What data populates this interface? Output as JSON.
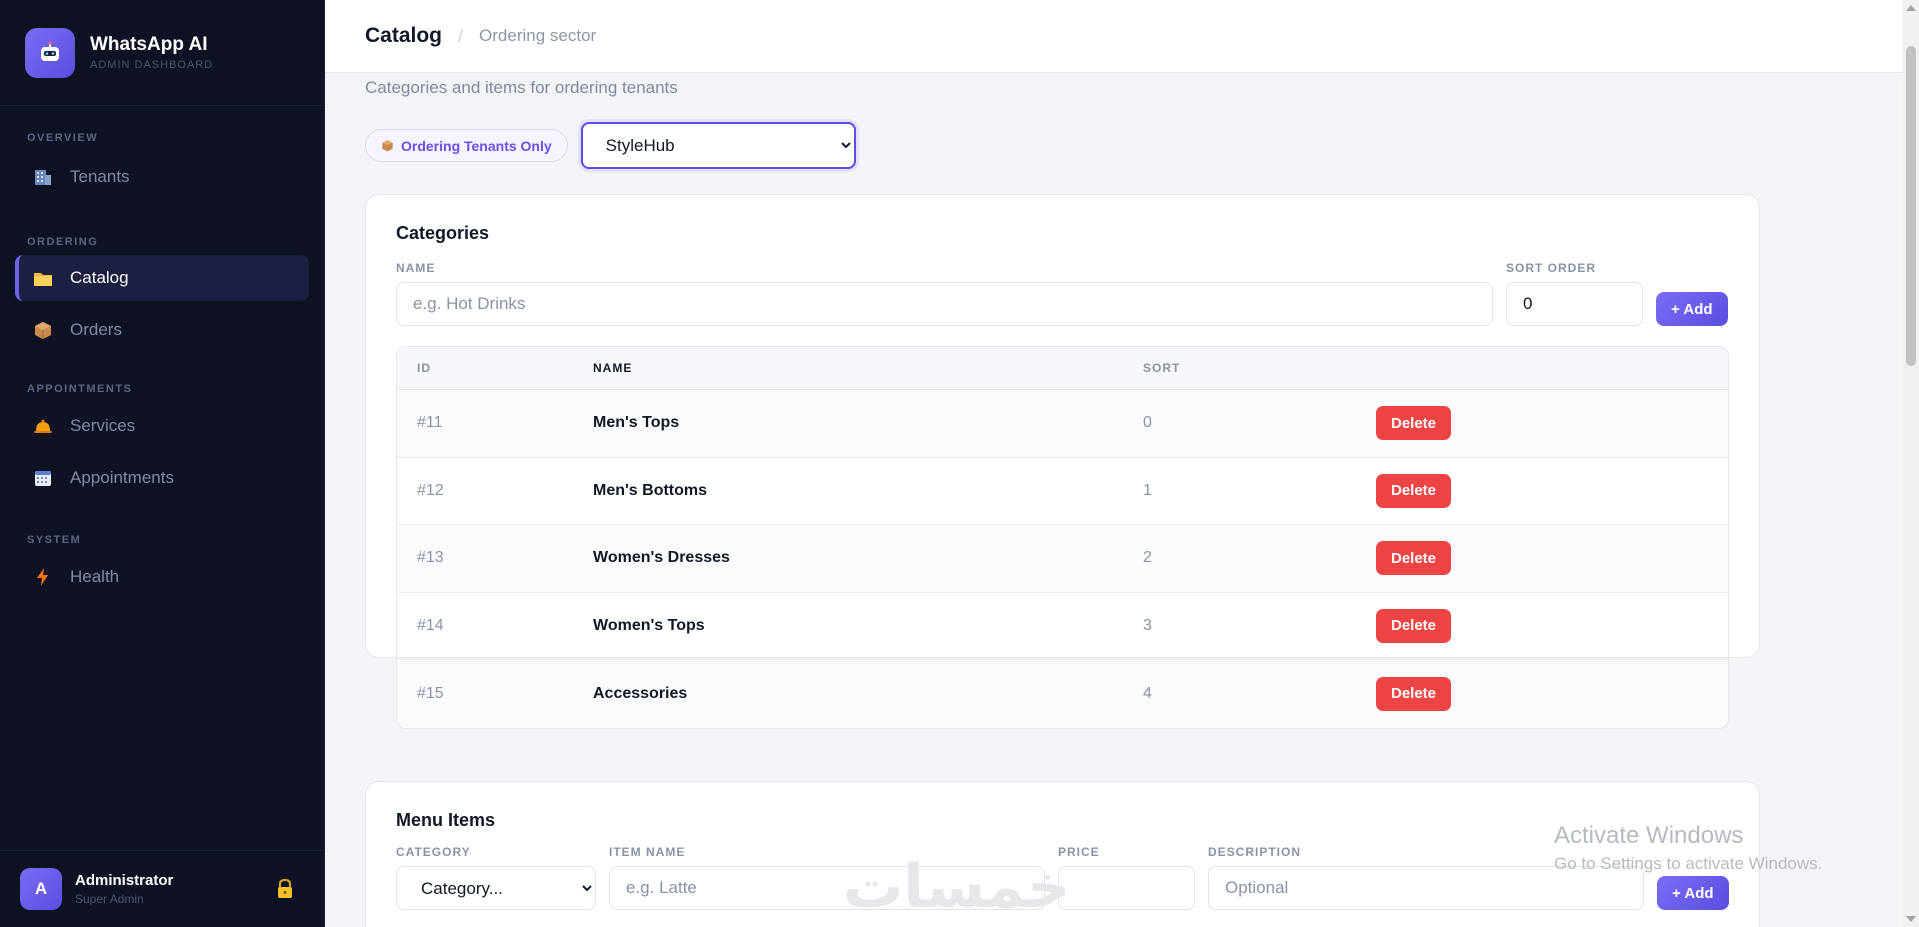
{
  "brand": {
    "name": "WhatsApp AI",
    "subtitle": "ADMIN DASHBOARD"
  },
  "sidebar": {
    "sections": [
      {
        "title": "OVERVIEW",
        "items": [
          {
            "label": "Tenants",
            "icon": "building-icon",
            "active": false
          }
        ]
      },
      {
        "title": "ORDERING",
        "items": [
          {
            "label": "Catalog",
            "icon": "folder-icon",
            "active": true
          },
          {
            "label": "Orders",
            "icon": "package-icon",
            "active": false
          }
        ]
      },
      {
        "title": "APPOINTMENTS",
        "items": [
          {
            "label": "Services",
            "icon": "bell-icon",
            "active": false
          },
          {
            "label": "Appointments",
            "icon": "calendar-icon",
            "active": false
          }
        ]
      },
      {
        "title": "SYSTEM",
        "items": [
          {
            "label": "Health",
            "icon": "lightning-icon",
            "active": false
          }
        ]
      }
    ]
  },
  "user": {
    "initial": "A",
    "name": "Administrator",
    "role": "Super Admin"
  },
  "header": {
    "title": "Catalog",
    "sector": "Ordering sector"
  },
  "page": {
    "subtitle": "Categories and items for ordering tenants"
  },
  "filter": {
    "pill_label": "Ordering Tenants Only",
    "tenant_selected": "StyleHub"
  },
  "categories": {
    "title": "Categories",
    "name_label": "NAME",
    "name_placeholder": "e.g. Hot Drinks",
    "sort_label": "SORT ORDER",
    "sort_value": "0",
    "add_label": "+ Add",
    "columns": [
      "ID",
      "NAME",
      "SORT",
      ""
    ],
    "rows": [
      {
        "id": "#11",
        "name": "Men's Tops",
        "sort": "0",
        "action": "Delete"
      },
      {
        "id": "#12",
        "name": "Men's Bottoms",
        "sort": "1",
        "action": "Delete"
      },
      {
        "id": "#13",
        "name": "Women's Dresses",
        "sort": "2",
        "action": "Delete"
      },
      {
        "id": "#14",
        "name": "Women's Tops",
        "sort": "3",
        "action": "Delete"
      },
      {
        "id": "#15",
        "name": "Accessories",
        "sort": "4",
        "action": "Delete"
      }
    ]
  },
  "menu_items": {
    "title": "Menu Items",
    "category_label": "CATEGORY",
    "category_selected": "Category...",
    "item_name_label": "ITEM NAME",
    "item_name_placeholder": "e.g. Latte",
    "price_label": "PRICE",
    "description_label": "DESCRIPTION",
    "description_placeholder": "Optional",
    "add_label": "+ Add"
  },
  "overlay": {
    "activate_title": "Activate Windows",
    "activate_sub": "Go to Settings to activate Windows.",
    "arabic_watermark": "خمسات"
  }
}
